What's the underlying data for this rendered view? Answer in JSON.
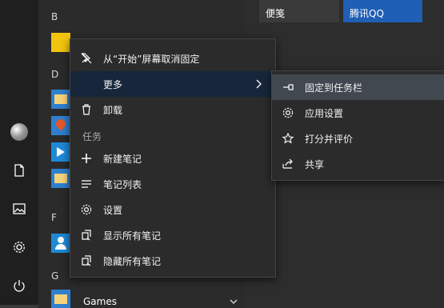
{
  "colors": {
    "rail_bg": "#1f1f1f",
    "list_bg": "#2b2b2b",
    "menu_bg": "#2b2b2b",
    "highlight_more": "#17263a",
    "highlight_pin": "#41484f",
    "tile_blue": "#1f5fb5",
    "tile_dark": "#3a3a3a",
    "folder_yellow": "#f1c40f",
    "app_blue": "#1e8ad6"
  },
  "tiles": [
    {
      "label": "便笺"
    },
    {
      "label": "腾讯QQ"
    }
  ],
  "app_list": {
    "letters": [
      "B",
      "D",
      "F",
      "G"
    ],
    "games_label": "Games"
  },
  "context_menu": {
    "unpin_label": "从“开始”屏幕取消固定",
    "more_label": "更多",
    "uninstall_label": "卸载",
    "tasks_section": "任务",
    "tasks": [
      {
        "label": "新建笔记",
        "icon": "plus-icon"
      },
      {
        "label": "笔记列表",
        "icon": "list-icon"
      },
      {
        "label": "设置",
        "icon": "gear-icon"
      },
      {
        "label": "显示所有笔记",
        "icon": "show-notes-icon"
      },
      {
        "label": "隐藏所有笔记",
        "icon": "hide-notes-icon"
      }
    ]
  },
  "submenu": {
    "items": [
      {
        "label": "固定到任务栏",
        "icon": "pin-icon"
      },
      {
        "label": "应用设置",
        "icon": "gear-icon"
      },
      {
        "label": "打分并评价",
        "icon": "star-icon"
      },
      {
        "label": "共享",
        "icon": "share-icon"
      }
    ]
  }
}
